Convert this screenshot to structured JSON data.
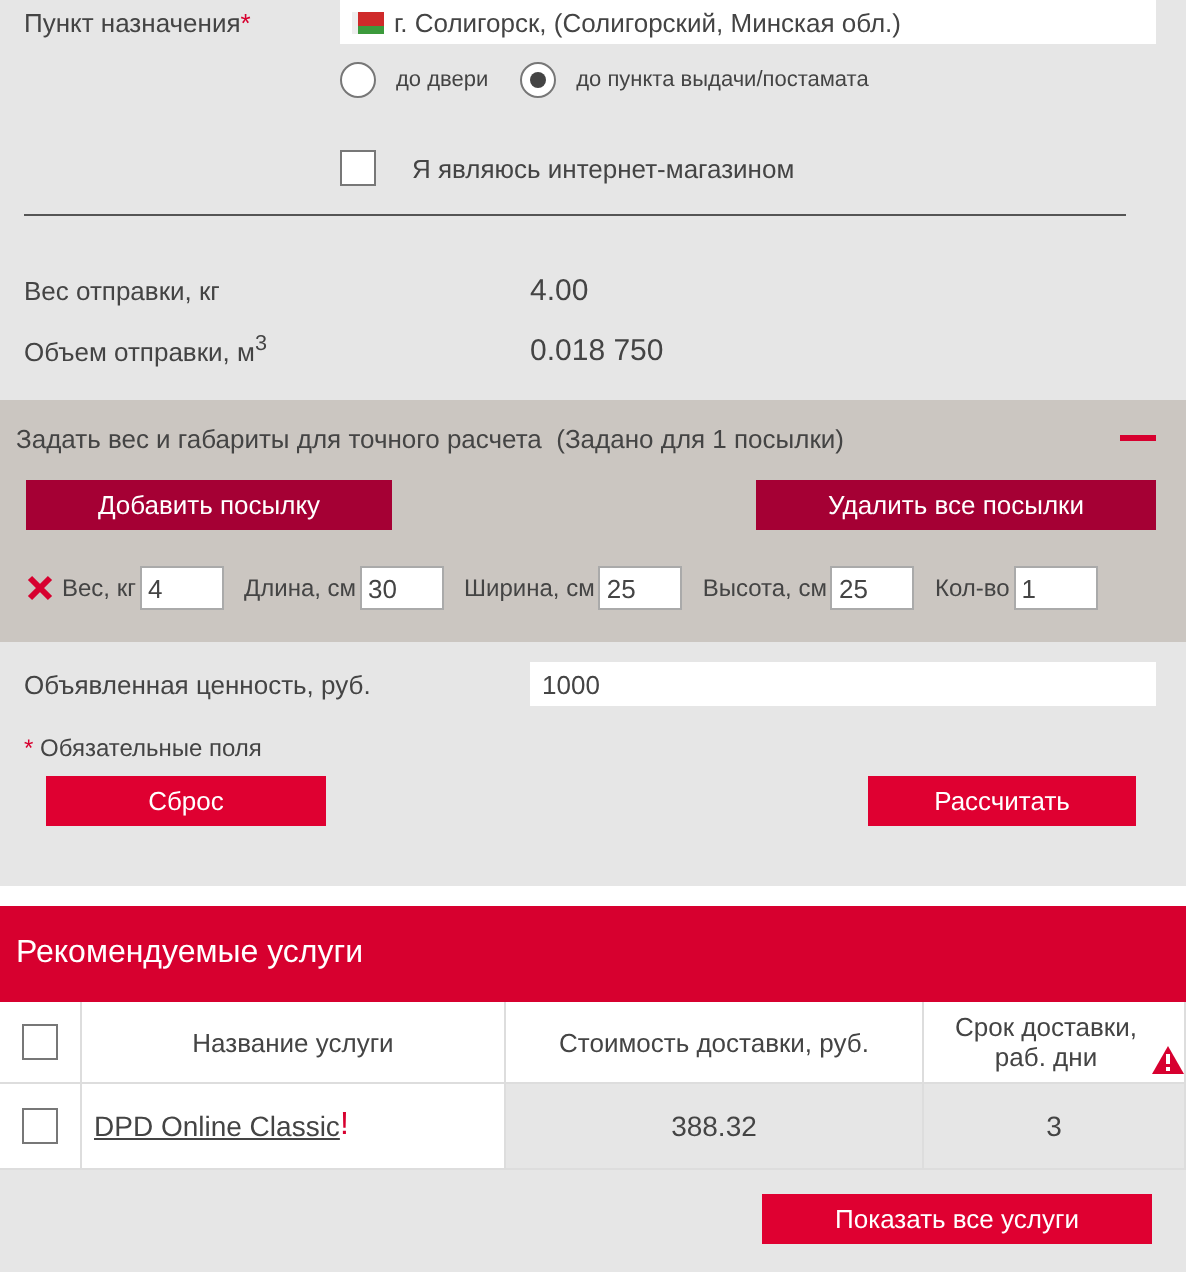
{
  "destination": {
    "label": "Пункт назначения",
    "required_mark": "*",
    "value": "г. Солигорск, (Солигорский, Минская обл.)"
  },
  "delivery_options": [
    {
      "label": "до двери",
      "selected": false
    },
    {
      "label": "до пункта выдачи/постамата",
      "selected": true
    }
  ],
  "shop_checkbox": {
    "label": "Я являюсь интернет-магазином",
    "checked": false
  },
  "summary": [
    {
      "label": "Вес отправки, кг",
      "value": "4.00"
    },
    {
      "label": "Объем отправки, м$^{3}$",
      "value": "0.018 750"
    }
  ],
  "parcels": {
    "title": "Задать вес и габариты для точного расчета",
    "note": "(Задано для 1 посылки)",
    "expanded": true,
    "buttons": [
      "Добавить посылку",
      "Удалить все посылки"
    ],
    "fields": [
      {
        "label": "Вес, кг",
        "value": "4"
      },
      {
        "label": "Длина, см",
        "value": "30"
      },
      {
        "label": "Ширина, см",
        "value": "25"
      },
      {
        "label": "Высота, см",
        "value": "25"
      },
      {
        "label": "Кол-во",
        "value": "1"
      }
    ]
  },
  "declared_value": {
    "label": "Объявленная ценность, руб.",
    "value": "1000"
  },
  "required_note": {
    "mark": "*",
    "text": "Обязательные поля"
  },
  "actions": [
    "Сброс",
    "Рассчитать"
  ],
  "services": {
    "title": "Рекомендуемые услуги",
    "all_checked": false,
    "columns": [
      "Название услуги",
      "Стоимость доставки, руб.",
      "Срок доставки, раб. дни"
    ],
    "rows": [
      {
        "checked": false,
        "name": "DPD Online Classic",
        "alert": "!",
        "cost": "388.32",
        "days": "3"
      }
    ],
    "button": "Показать все услуги"
  }
}
